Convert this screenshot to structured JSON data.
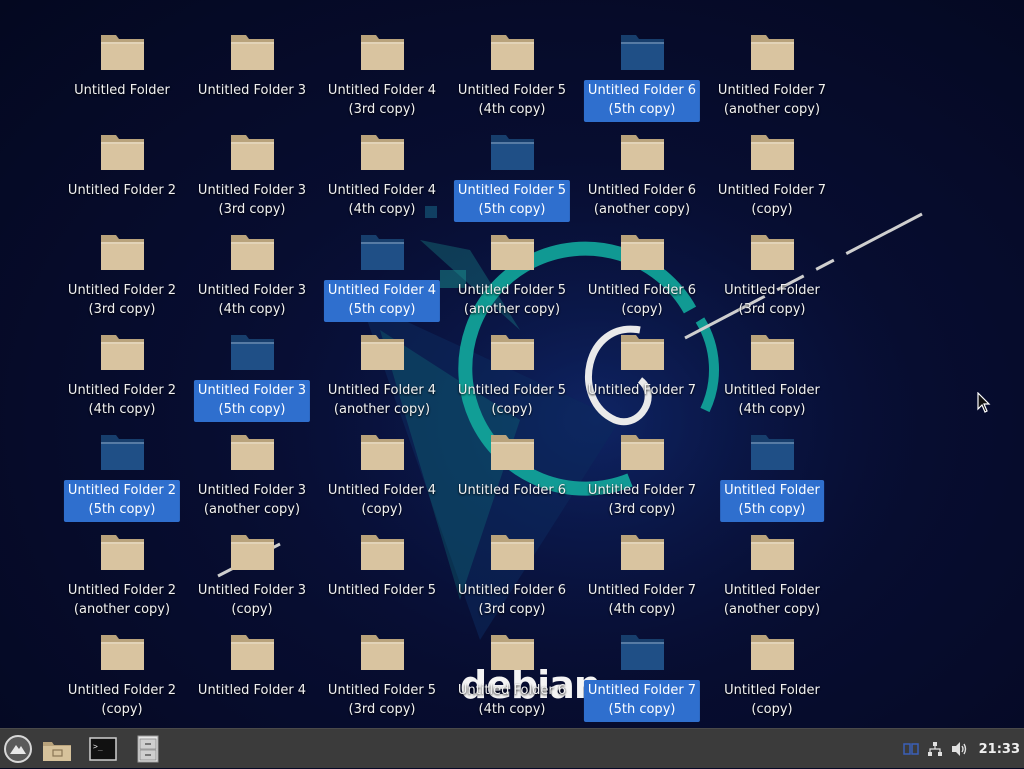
{
  "desktop": {
    "icons": [
      {
        "l1": "Untitled Folder",
        "l2": "",
        "selected": false
      },
      {
        "l1": "Untitled Folder 3",
        "l2": "",
        "selected": false
      },
      {
        "l1": "Untitled Folder 4",
        "l2": "(3rd copy)",
        "selected": false
      },
      {
        "l1": "Untitled Folder 5",
        "l2": "(4th copy)",
        "selected": false
      },
      {
        "l1": "Untitled Folder 6",
        "l2": "(5th copy)",
        "selected": true
      },
      {
        "l1": "Untitled Folder 7",
        "l2": "(another copy)",
        "selected": false
      },
      {
        "l1": "Untitled Folder 2",
        "l2": "",
        "selected": false
      },
      {
        "l1": "Untitled Folder 3",
        "l2": "(3rd copy)",
        "selected": false
      },
      {
        "l1": "Untitled Folder 4",
        "l2": "(4th copy)",
        "selected": false
      },
      {
        "l1": "Untitled Folder 5",
        "l2": "(5th copy)",
        "selected": true
      },
      {
        "l1": "Untitled Folder 6",
        "l2": "(another copy)",
        "selected": false
      },
      {
        "l1": "Untitled Folder 7",
        "l2": "(copy)",
        "selected": false
      },
      {
        "l1": "Untitled Folder 2",
        "l2": "(3rd copy)",
        "selected": false
      },
      {
        "l1": "Untitled Folder 3",
        "l2": "(4th copy)",
        "selected": false
      },
      {
        "l1": "Untitled Folder 4",
        "l2": "(5th copy)",
        "selected": true
      },
      {
        "l1": "Untitled Folder 5",
        "l2": "(another copy)",
        "selected": false
      },
      {
        "l1": "Untitled Folder 6",
        "l2": "(copy)",
        "selected": false
      },
      {
        "l1": "Untitled Folder",
        "l2": "(3rd copy)",
        "selected": false
      },
      {
        "l1": "Untitled Folder 2",
        "l2": "(4th copy)",
        "selected": false
      },
      {
        "l1": "Untitled Folder 3",
        "l2": "(5th copy)",
        "selected": true
      },
      {
        "l1": "Untitled Folder 4",
        "l2": "(another copy)",
        "selected": false
      },
      {
        "l1": "Untitled Folder 5",
        "l2": "(copy)",
        "selected": false
      },
      {
        "l1": "Untitled Folder 7",
        "l2": "",
        "selected": false
      },
      {
        "l1": "Untitled Folder",
        "l2": "(4th copy)",
        "selected": false
      },
      {
        "l1": "Untitled Folder 2",
        "l2": "(5th copy)",
        "selected": true
      },
      {
        "l1": "Untitled Folder 3",
        "l2": "(another copy)",
        "selected": false
      },
      {
        "l1": "Untitled Folder 4",
        "l2": "(copy)",
        "selected": false
      },
      {
        "l1": "Untitled Folder 6",
        "l2": "",
        "selected": false
      },
      {
        "l1": "Untitled Folder 7",
        "l2": "(3rd copy)",
        "selected": false
      },
      {
        "l1": "Untitled Folder",
        "l2": "(5th copy)",
        "selected": true
      },
      {
        "l1": "Untitled Folder 2",
        "l2": "(another copy)",
        "selected": false
      },
      {
        "l1": "Untitled Folder 3",
        "l2": "(copy)",
        "selected": false
      },
      {
        "l1": "Untitled Folder 5",
        "l2": "",
        "selected": false
      },
      {
        "l1": "Untitled Folder 6",
        "l2": "(3rd copy)",
        "selected": false
      },
      {
        "l1": "Untitled Folder 7",
        "l2": "(4th copy)",
        "selected": false
      },
      {
        "l1": "Untitled Folder",
        "l2": "(another copy)",
        "selected": false
      },
      {
        "l1": "Untitled Folder 2",
        "l2": "(copy)",
        "selected": false
      },
      {
        "l1": "Untitled Folder 4",
        "l2": "",
        "selected": false
      },
      {
        "l1": "Untitled Folder 5",
        "l2": "(3rd copy)",
        "selected": false
      },
      {
        "l1": "Untitled Folder 6",
        "l2": "(4th copy)",
        "selected": false
      },
      {
        "l1": "Untitled Folder 7",
        "l2": "(5th copy)",
        "selected": true
      },
      {
        "l1": "Untitled Folder",
        "l2": "(copy)",
        "selected": false
      }
    ]
  },
  "wallpaper": {
    "brand_text": "debian"
  },
  "taskbar": {
    "launchers": [
      {
        "name": "menu-icon"
      },
      {
        "name": "file-manager-icon"
      },
      {
        "name": "terminal-icon"
      },
      {
        "name": "file-cabinet-icon"
      }
    ],
    "tray_icons": [
      "display-icon",
      "network-icon",
      "volume-icon"
    ],
    "clock": "21:33"
  },
  "colors": {
    "selection": "#2f6fce",
    "folder": "#d9c4a0",
    "folder_selected": "#1f4f86",
    "taskbar": "#3b3b3b",
    "wallpaper_accent": "#12a89c"
  }
}
